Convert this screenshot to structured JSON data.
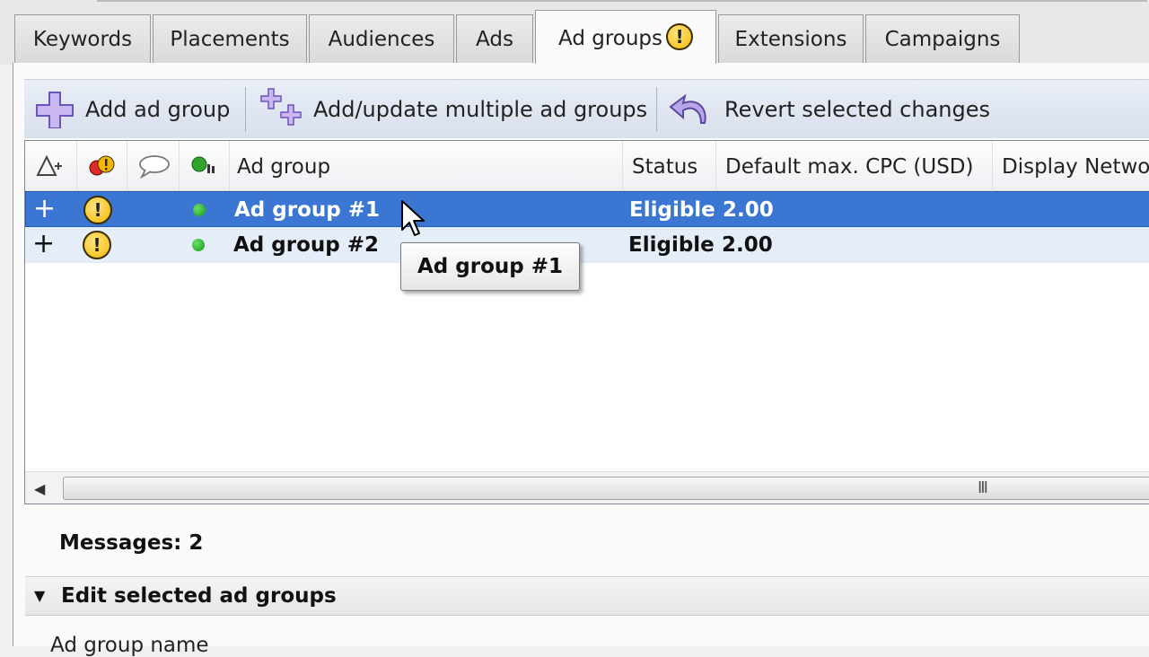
{
  "tabs": [
    {
      "label": "Keywords"
    },
    {
      "label": "Placements"
    },
    {
      "label": "Audiences"
    },
    {
      "label": "Ads"
    },
    {
      "label": "Ad groups",
      "active": true,
      "warning": "!"
    },
    {
      "label": "Extensions"
    },
    {
      "label": "Campaigns"
    }
  ],
  "toolbar": {
    "add_label": "Add ad group",
    "add_multiple_label": "Add/update multiple ad groups",
    "revert_label": "Revert selected changes"
  },
  "grid": {
    "columns": {
      "ad_group": "Ad group",
      "status": "Status",
      "default_cpc": "Default max. CPC (USD)",
      "display_network": "Display Netwo"
    },
    "rows": [
      {
        "expand": "+",
        "warning": "!",
        "name": "Ad group #1",
        "status": "Eligible",
        "cpc": "2.00",
        "selected": true
      },
      {
        "expand": "+",
        "warning": "!",
        "name": "Ad group #2",
        "status": "Eligible",
        "cpc": "2.00",
        "selected": false
      }
    ]
  },
  "tooltip": {
    "text": "Ad group #1"
  },
  "messages": {
    "label": "Messages: 2"
  },
  "edit_section": {
    "title": "Edit selected ad groups",
    "field_label": "Ad group name"
  },
  "scrollbar": {
    "grip": "III"
  },
  "colors": {
    "selected_row": "#3b76d3",
    "alt_row": "#e5edf8",
    "toolbar": "#dfe6f0",
    "warning": "#f2b705",
    "status_dot": "#159a15"
  },
  "icons": [
    "plus-icon",
    "multi-plus-icon",
    "revert-icon",
    "change-delta-icon",
    "error-warning-icon",
    "comment-icon",
    "status-icon",
    "warning-icon",
    "status-dot-icon",
    "scroll-left-arrow-icon",
    "collapse-triangle-icon",
    "mouse-cursor-icon"
  ]
}
